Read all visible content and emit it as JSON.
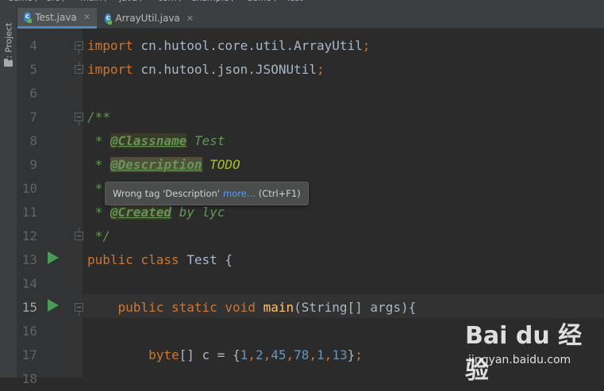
{
  "breadcrumb": {
    "items": [
      "demo",
      "src",
      "main",
      "java",
      "com",
      "example",
      "demo",
      "Test"
    ]
  },
  "tabs": [
    {
      "label": "Test.java",
      "icon": "class-icon",
      "active": true
    },
    {
      "label": "ArrayUtil.java",
      "icon": "class-icon",
      "active": false
    }
  ],
  "sidebar": {
    "project_label": "1: Project"
  },
  "editor": {
    "current_line": "15",
    "lines": [
      {
        "num": "4",
        "tokens": [
          {
            "t": "import",
            "c": "kw"
          },
          {
            "t": " cn.hutool.core.util.ArrayUtil",
            "c": ""
          },
          {
            "t": ";",
            "c": "punc"
          }
        ],
        "fold": "start"
      },
      {
        "num": "5",
        "tokens": [
          {
            "t": "import",
            "c": "kw"
          },
          {
            "t": " cn.hutool.json.JSONUtil",
            "c": ""
          },
          {
            "t": ";",
            "c": "punc"
          }
        ],
        "fold": "end"
      },
      {
        "num": "6",
        "tokens": [],
        "fold": ""
      },
      {
        "num": "7",
        "tokens": [
          {
            "t": "/**",
            "c": "doc"
          }
        ],
        "fold": "start"
      },
      {
        "num": "8",
        "tokens": [
          {
            "t": " * ",
            "c": "doc"
          },
          {
            "t": "@Classname",
            "c": "tag"
          },
          {
            "t": " Test",
            "c": "doc"
          }
        ],
        "fold": ""
      },
      {
        "num": "9",
        "tokens": [
          {
            "t": " * ",
            "c": "doc"
          },
          {
            "t": "@Description",
            "c": "tag warn"
          },
          {
            "t": " ",
            "c": "doc"
          },
          {
            "t": "TODO",
            "c": "todo"
          }
        ],
        "fold": ""
      },
      {
        "num": "10",
        "tokens": [
          {
            "t": " *",
            "c": "doc"
          }
        ],
        "fold": ""
      },
      {
        "num": "11",
        "tokens": [
          {
            "t": " * ",
            "c": "doc"
          },
          {
            "t": "@Created",
            "c": "tag"
          },
          {
            "t": " by lyc",
            "c": "doc"
          }
        ],
        "fold": ""
      },
      {
        "num": "12",
        "tokens": [
          {
            "t": " */",
            "c": "doc"
          }
        ],
        "fold": "end"
      },
      {
        "num": "13",
        "tokens": [
          {
            "t": "public class",
            "c": "kw"
          },
          {
            "t": " Test {",
            "c": ""
          }
        ],
        "fold": "",
        "run": true
      },
      {
        "num": "14",
        "tokens": [],
        "fold": ""
      },
      {
        "num": "15",
        "tokens": [
          {
            "t": "    public static void",
            "c": "kw"
          },
          {
            "t": " ",
            "c": ""
          },
          {
            "t": "main",
            "c": "fn"
          },
          {
            "t": "(String[] args){",
            "c": ""
          }
        ],
        "fold": "start",
        "run": true
      },
      {
        "num": "16",
        "tokens": [],
        "fold": ""
      },
      {
        "num": "17",
        "tokens": [
          {
            "t": "        byte",
            "c": "kw"
          },
          {
            "t": "[] c = {",
            "c": ""
          },
          {
            "t": "1",
            "c": "num"
          },
          {
            "t": ",",
            "c": "punc"
          },
          {
            "t": "2",
            "c": "num"
          },
          {
            "t": ",",
            "c": "punc"
          },
          {
            "t": "45",
            "c": "num"
          },
          {
            "t": ",",
            "c": "punc"
          },
          {
            "t": "78",
            "c": "num"
          },
          {
            "t": ",",
            "c": "punc"
          },
          {
            "t": "1",
            "c": "num"
          },
          {
            "t": ",",
            "c": "punc"
          },
          {
            "t": "13",
            "c": "num"
          },
          {
            "t": "}",
            "c": ""
          },
          {
            "t": ";",
            "c": "punc"
          }
        ],
        "fold": ""
      },
      {
        "num": "18",
        "tokens": [],
        "fold": ""
      }
    ]
  },
  "tooltip": {
    "message": "Wrong tag 'Description'",
    "link": "more...",
    "shortcut": "(Ctrl+F1)"
  },
  "watermark": {
    "logo_text": "Bai du 经验",
    "sub_text": "jingyan.baidu.com"
  }
}
